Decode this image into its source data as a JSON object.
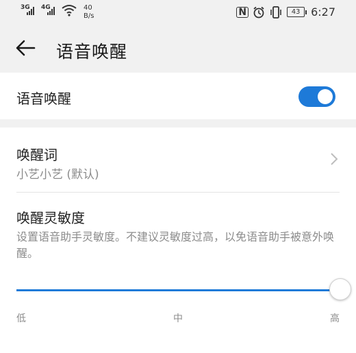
{
  "status_bar": {
    "signal1_tag": "3G",
    "signal2_tag": "4G",
    "net_speed_value": "40",
    "net_speed_unit": "B/s",
    "battery_level": "43",
    "time": "6:27"
  },
  "app_bar": {
    "title": "语音唤醒"
  },
  "voice_wakeup": {
    "label": "语音唤醒",
    "enabled": true,
    "accent_color": "#1e7ad8"
  },
  "wake_word": {
    "title": "唤醒词",
    "value": "小艺小艺 (默认)"
  },
  "sensitivity": {
    "title": "唤醒灵敏度",
    "description": "设置语音助手灵敏度。不建议灵敏度过高，以免语音助手被意外唤醒。",
    "level_fraction": 1.0,
    "labels": {
      "low": "低",
      "mid": "中",
      "high": "高"
    }
  }
}
